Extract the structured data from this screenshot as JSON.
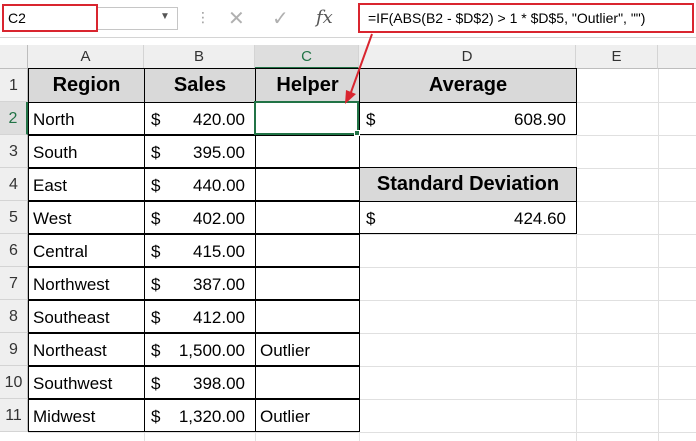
{
  "name_box": {
    "value": "C2"
  },
  "formula_bar": {
    "formula": "=IF(ABS(B2 - $D$2) > 1 * $D$5, \"Outlier\", \"\")",
    "fx_label": "fx"
  },
  "columns": [
    "A",
    "B",
    "C",
    "D",
    "E"
  ],
  "rows": [
    "1",
    "2",
    "3",
    "4",
    "5",
    "6",
    "7",
    "8",
    "9",
    "10",
    "11"
  ],
  "table": {
    "headers": {
      "region": "Region",
      "sales": "Sales",
      "helper": "Helper"
    },
    "currency_symbol": "$",
    "rows": [
      {
        "region": "North",
        "sales": "420.00",
        "helper": ""
      },
      {
        "region": "South",
        "sales": "395.00",
        "helper": ""
      },
      {
        "region": "East",
        "sales": "440.00",
        "helper": ""
      },
      {
        "region": "West",
        "sales": "402.00",
        "helper": ""
      },
      {
        "region": "Central",
        "sales": "415.00",
        "helper": ""
      },
      {
        "region": "Northwest",
        "sales": "387.00",
        "helper": ""
      },
      {
        "region": "Southeast",
        "sales": "412.00",
        "helper": ""
      },
      {
        "region": "Northeast",
        "sales": "1,500.00",
        "helper": "Outlier"
      },
      {
        "region": "Southwest",
        "sales": "398.00",
        "helper": ""
      },
      {
        "region": "Midwest",
        "sales": "1,320.00",
        "helper": "Outlier"
      }
    ]
  },
  "stats": {
    "average_label": "Average",
    "average_value": "608.90",
    "stdev_label": "Standard Deviation",
    "stdev_value": "424.60"
  },
  "colors": {
    "highlight": "#d9252f",
    "selection": "#217346",
    "header_fill": "#d9d9d9"
  }
}
